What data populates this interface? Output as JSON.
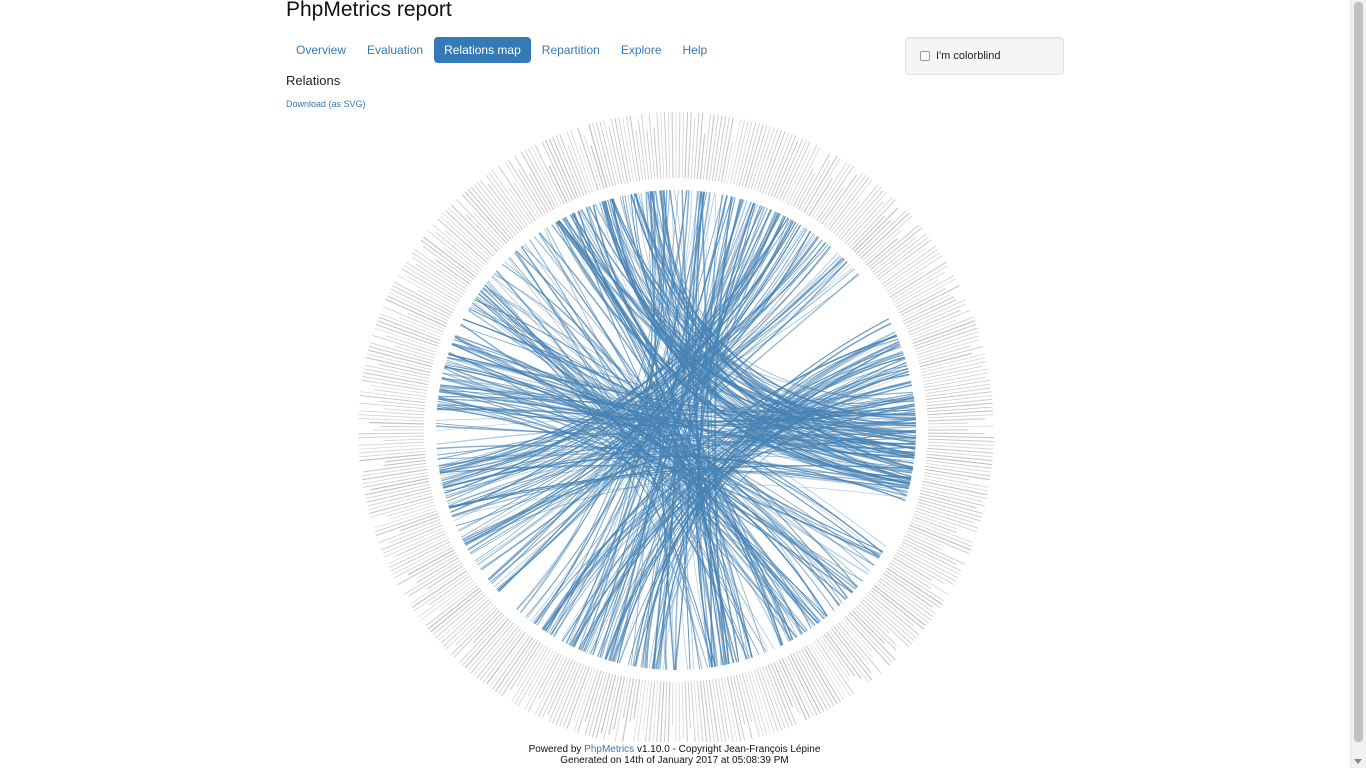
{
  "header": {
    "title": "PhpMetrics report"
  },
  "nav": {
    "tabs": [
      {
        "label": "Overview",
        "active": false
      },
      {
        "label": "Evaluation",
        "active": false
      },
      {
        "label": "Relations map",
        "active": true
      },
      {
        "label": "Repartition",
        "active": false
      },
      {
        "label": "Explore",
        "active": false
      },
      {
        "label": "Help",
        "active": false
      }
    ]
  },
  "options": {
    "colorblind_label": "I'm colorblind",
    "colorblind_checked": false
  },
  "section": {
    "title": "Relations",
    "download_label": "Download (as SVG)"
  },
  "colors": {
    "link": "#337ab7",
    "edge": "#4682b4",
    "node_label": "#bbbbbb",
    "active_tab_bg": "#337ab7"
  },
  "footer": {
    "powered_prefix": "Powered by ",
    "powered_link": "PhpMetrics",
    "powered_suffix": " v1.10.0 - Copyright Jean-François Lépine",
    "generated": "Generated on 14th of January 2017 at 05:08:39 PM"
  }
}
